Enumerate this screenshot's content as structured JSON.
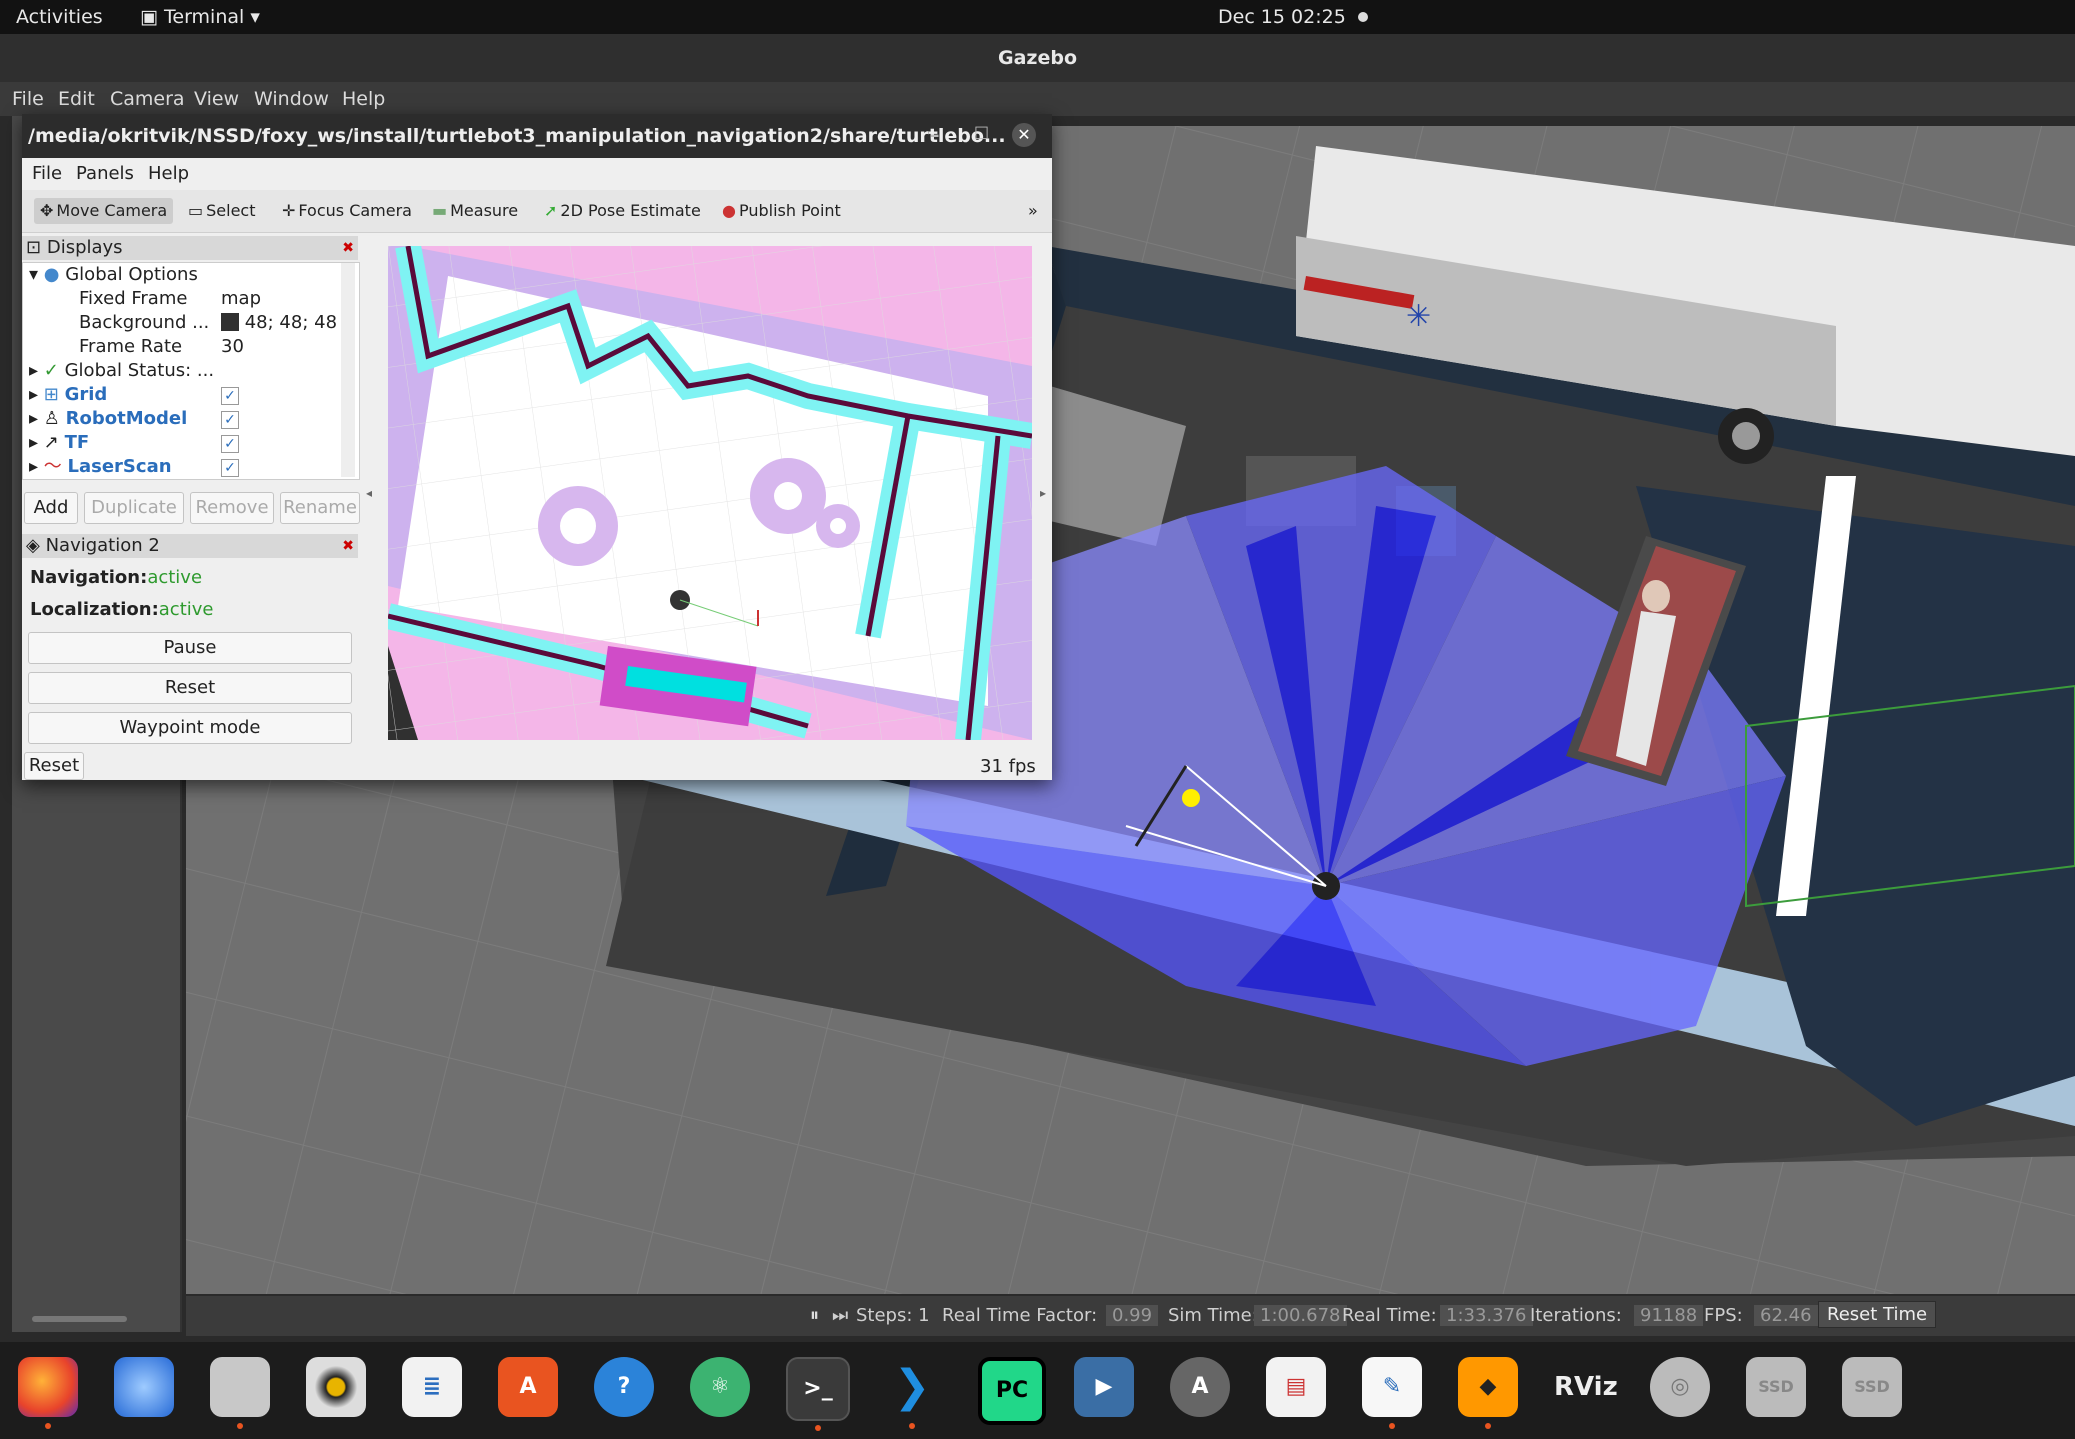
{
  "topbar": {
    "activities": "Activities",
    "terminal_label": "Terminal",
    "datetime": "Dec 15  02:25"
  },
  "gazebo": {
    "title": "Gazebo",
    "menu": [
      "File",
      "Edit",
      "Camera",
      "View",
      "Window",
      "Help"
    ],
    "status": {
      "steps_label": "Steps: 1",
      "rtf_label": "Real Time Factor:",
      "rtf_value": "0.99",
      "sim_time_label": "Sim Time:",
      "sim_time_value": "1:00.678",
      "real_time_label": "Real Time:",
      "real_time_value": "1:33.376",
      "iterations_label": "Iterations:",
      "iterations_value": "91188",
      "fps_label": "FPS:",
      "fps_value": "62.46",
      "reset_time": "Reset Time"
    }
  },
  "rviz": {
    "title": "/media/okritvik/NSSD/foxy_ws/install/turtlebot3_manipulation_navigation2/share/turtlebo...",
    "menu": [
      "File",
      "Panels",
      "Help"
    ],
    "tools": [
      "Move Camera",
      "Select",
      "Focus Camera",
      "Measure",
      "2D Pose Estimate",
      "Publish Point"
    ],
    "displays": {
      "header": "Displays",
      "global_options": "Global Options",
      "fixed_frame_label": "Fixed Frame",
      "fixed_frame_value": "map",
      "background_label": "Background ...",
      "background_value": "48; 48; 48",
      "frame_rate_label": "Frame Rate",
      "frame_rate_value": "30",
      "global_status": "Global Status: ...",
      "items": [
        "Grid",
        "RobotModel",
        "TF",
        "LaserScan"
      ]
    },
    "buttons": {
      "add": "Add",
      "duplicate": "Duplicate",
      "remove": "Remove",
      "rename": "Rename"
    },
    "nav2": {
      "header": "Navigation 2",
      "navigation_label": "Navigation:",
      "navigation_value": "active",
      "localization_label": "Localization:",
      "localization_value": "active",
      "pause": "Pause",
      "reset": "Reset",
      "waypoint": "Waypoint mode"
    },
    "bottom_reset": "Reset",
    "fps": "31 fps"
  },
  "colors": {
    "accent": "#e95420",
    "laser_blue": "#3a3aff",
    "costmap_cyan": "#7ff3f3",
    "costmap_pink": "#f0b0e0"
  },
  "dock": [
    "firefox-icon",
    "thunderbird-icon",
    "files-icon",
    "rhythmbox-icon",
    "writer-icon",
    "software-icon",
    "help-icon",
    "atom-icon",
    "terminal-icon",
    "vscode-icon",
    "pycharm-icon",
    "video-icon",
    "updater-icon",
    "viewer-icon",
    "text-editor-icon",
    "sublime-icon",
    "rviz-icon",
    "disk-icon",
    "ssd-icon",
    "ssd-icon-2"
  ],
  "dock_labels": {
    "pycharm": "PC",
    "rviz": "RViz",
    "ssd": "SSD"
  }
}
